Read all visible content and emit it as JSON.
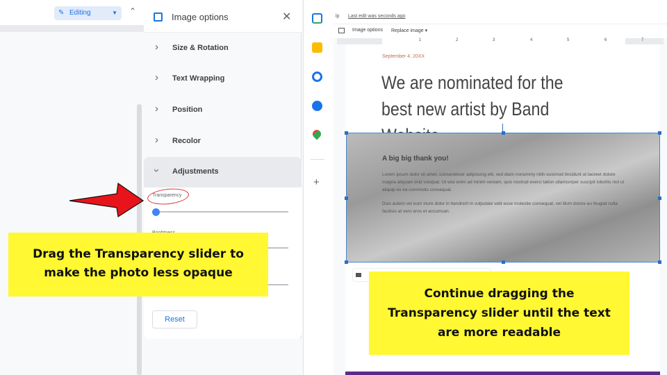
{
  "left": {
    "editing_label": "Editing",
    "panel": {
      "title": "Image options",
      "items": [
        "Size & Rotation",
        "Text Wrapping",
        "Position",
        "Recolor",
        "Adjustments"
      ],
      "transparency_label": "Transparency",
      "transparency_value": 0,
      "brightness_label": "Brightness",
      "reset_label": "Reset"
    },
    "callout": "Drag the Transparency slider to make the photo less opaque",
    "side_icons": [
      "calendar-icon",
      "keep-icon",
      "tasks-icon",
      "contacts-icon",
      "maps-icon",
      "add-icon"
    ]
  },
  "right": {
    "menu_tail": "lp",
    "last_edit": "Last edit was seconds ago",
    "toolbar": {
      "image_options": "Image options",
      "replace_image": "Replace image ▾"
    },
    "ruler": [
      "1",
      "2",
      "3",
      "4",
      "5",
      "6",
      "7"
    ],
    "doc": {
      "date": "September 4, 20XX",
      "title": "We are nominated for the best new artist by Band Website",
      "img_heading": "A big big thank you!",
      "para1": "Lorem ipsum dolor sit amet, consectetuer adipiscing elit, sed diam nonummy nibh euismod tincidunt ut laoreet dolore magna aliquam erat volutpat. Ut wisi enim ad minim veniam, quis nostrud exerci tation ullamcorper suscipit lobortis nisl ut aliquip ex ea commodo consequat.",
      "para2": "Duis autem vel eum iriure dolor in hendrerit in vulputate velit esse molestie consequat, vel illum dolore eu feugiat nulla facilisis at vero eros et accumsan."
    },
    "callout": "Continue dragging the Transparency slider until the text are more readable"
  },
  "colors": {
    "accent": "#1a73e8",
    "callout": "#fff832",
    "arrow": "#e8141b",
    "date": "#c0714a",
    "footer": "#5b2a86"
  }
}
